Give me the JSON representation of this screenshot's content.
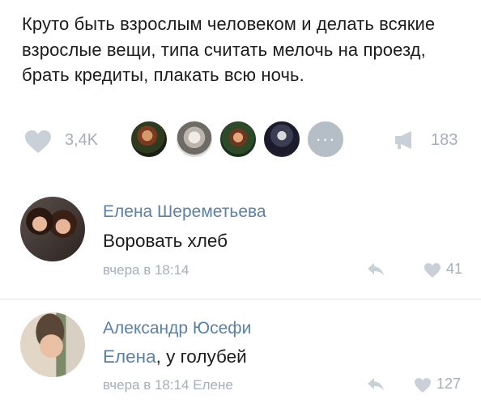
{
  "post": {
    "text": "Круто быть взрослым человеком и делать всякие взрослые вещи, типа считать мелочь на проезд, брать кредиты, плакать всю ночь."
  },
  "stats": {
    "likes": "3,4K",
    "more": "···",
    "shares": "183",
    "icons": {
      "like": "heart-icon",
      "share": "megaphone-icon",
      "more": "ellipsis-icon"
    }
  },
  "comments": [
    {
      "author": "Елена Шереметьева",
      "text": "Воровать хлеб",
      "time": "вчера в 18:14",
      "likes": "41"
    },
    {
      "author": "Александр Юсефи",
      "reply_to": "Елена",
      "text": ", у голубей",
      "time": "вчера в 18:14 Елене",
      "likes": "127"
    }
  ],
  "colors": {
    "link": "#5b81a8",
    "muted": "#a6aeb8",
    "text": "#1c1c1c"
  }
}
